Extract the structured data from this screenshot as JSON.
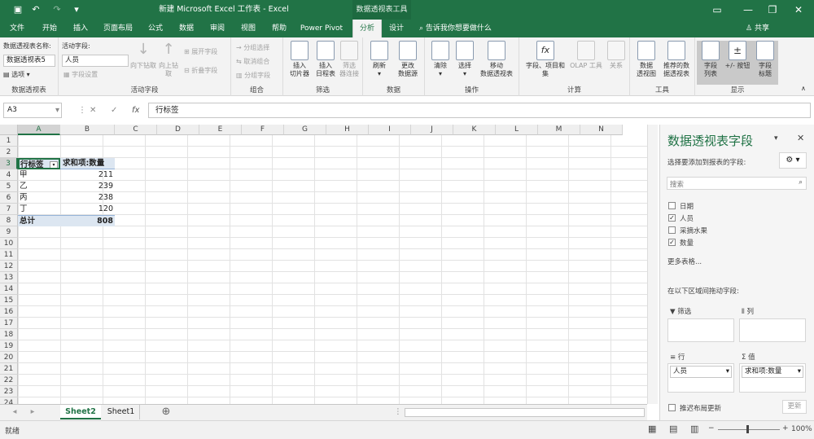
{
  "title": {
    "window_title": "新建 Microsoft Excel 工作表 - Excel",
    "context_tab": "数据透视表工具",
    "undo_icon": "↶",
    "redo_icon": "↷",
    "save_icon": "▣"
  },
  "tabs": {
    "items": [
      "文件",
      "开始",
      "插入",
      "页面布局",
      "公式",
      "数据",
      "审阅",
      "视图",
      "帮助",
      "Power Pivot",
      "分析",
      "设计"
    ],
    "active": "分析",
    "tell_me": "告诉我你想要做什么",
    "share": "共享"
  },
  "ribbon": {
    "pivot_name_label": "数据透视表名称:",
    "pivot_name_value": "数据透视表5",
    "options_label": "选项",
    "group_pivot": "数据透视表",
    "active_field_label": "活动字段:",
    "active_field_value": "人员",
    "field_settings": "字段设置",
    "drill_down": "向下钻取",
    "drill_up": "向上钻\n取",
    "expand_field": "展开字段",
    "collapse_field": "折叠字段",
    "group_active_field": "活动字段",
    "group_selection": "分组选择",
    "ungroup": "取消组合",
    "group_field": "分组字段",
    "group_group": "组合",
    "insert_slicer": "插入\n切片器",
    "insert_timeline": "插入\n日程表",
    "filter_connections": "筛选\n器连接",
    "group_filter": "筛选",
    "refresh": "刷新",
    "change_source": "更改\n数据源",
    "group_data": "数据",
    "clear": "清除",
    "select": "选择",
    "move_pivot": "移动\n数据透视表",
    "group_actions": "操作",
    "fields_items_sets": "字段、项目和\n集",
    "olap_tools": "OLAP 工具",
    "relationships": "关系",
    "group_calc": "计算",
    "pivot_chart": "数据\n透视图",
    "recommended_pivot": "推荐的数\n据透视表",
    "group_tools": "工具",
    "field_list": "字段\n列表",
    "plus_minus": "+/- 按钮",
    "field_headers": "字段\n标题",
    "group_show": "显示"
  },
  "formula_bar": {
    "name_box": "A3",
    "cancel": "✕",
    "enter": "✓",
    "fx": "fx",
    "content": "行标签"
  },
  "grid": {
    "columns": [
      "A",
      "B",
      "C",
      "D",
      "E",
      "F",
      "G",
      "H",
      "I",
      "J",
      "K",
      "L",
      "M",
      "N"
    ],
    "rows": [
      "1",
      "2",
      "3",
      "4",
      "5",
      "6",
      "7",
      "8",
      "9",
      "10",
      "11",
      "12",
      "13",
      "14",
      "15",
      "16",
      "17",
      "18",
      "19",
      "20",
      "21",
      "22",
      "23",
      "24"
    ],
    "pivot": {
      "header_label": "行标签",
      "header_value": "求和项:数量",
      "rows": [
        {
          "label": "甲",
          "value": "211"
        },
        {
          "label": "乙",
          "value": "239"
        },
        {
          "label": "丙",
          "value": "238"
        },
        {
          "label": "丁",
          "value": "120"
        }
      ],
      "total_label": "总计",
      "total_value": "808"
    }
  },
  "sheets": {
    "tabs": [
      "Sheet2",
      "Sheet1"
    ],
    "active": "Sheet2",
    "add": "⊕"
  },
  "status": {
    "ready": "就绪",
    "zoom": "100%"
  },
  "panel": {
    "title": "数据透视表字段",
    "choose_label": "选择要添加到报表的字段:",
    "search_placeholder": "搜索",
    "fields": [
      {
        "name": "日期",
        "checked": false
      },
      {
        "name": "人员",
        "checked": true
      },
      {
        "name": "采摘水果",
        "checked": false
      },
      {
        "name": "数量",
        "checked": true
      }
    ],
    "more_tables": "更多表格...",
    "drag_label": "在以下区域间拖动字段:",
    "filters_label": "筛选",
    "columns_label": "列",
    "rows_label": "行",
    "values_label": "值",
    "rows_field": "人员",
    "values_field": "求和项:数量",
    "defer_label": "推迟布局更新",
    "update_button": "更新"
  }
}
